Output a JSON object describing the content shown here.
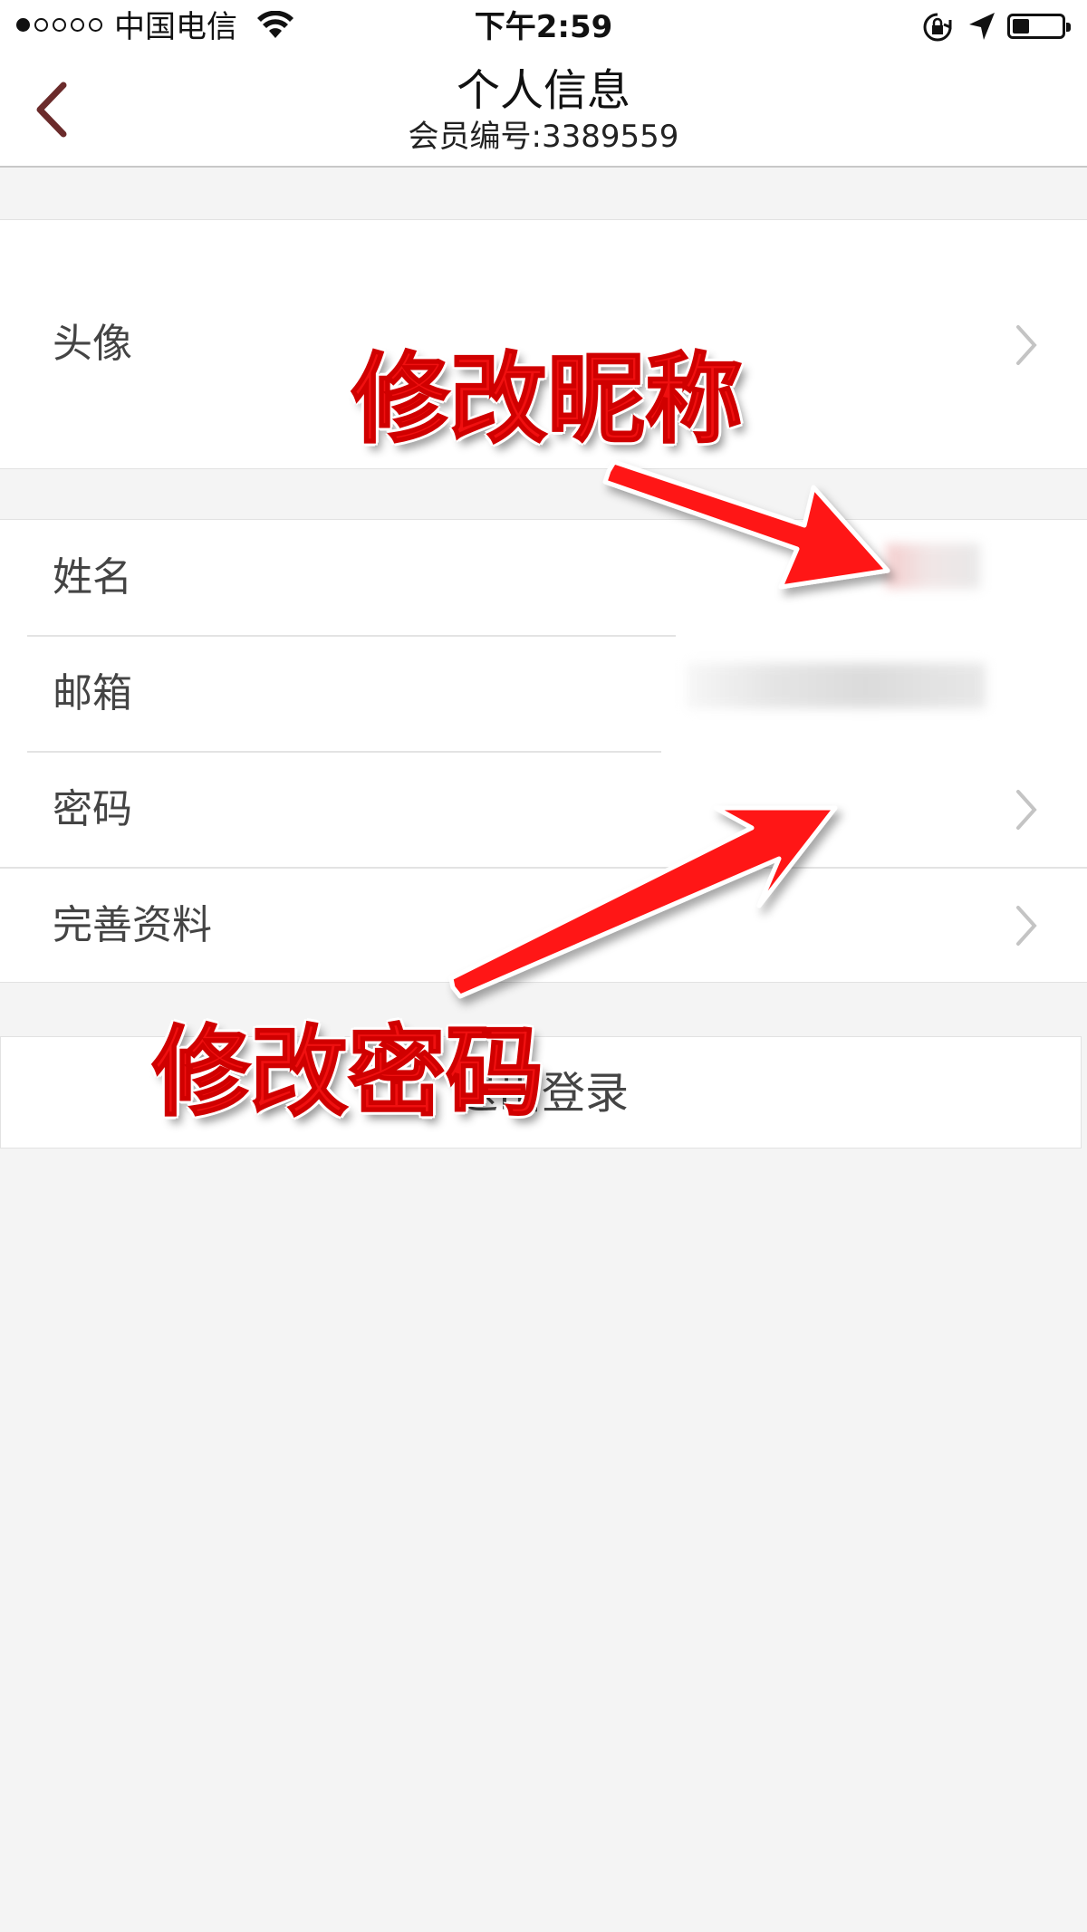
{
  "status_bar": {
    "carrier": "中国电信",
    "time": "下午2:59",
    "signal_filled": 1,
    "signal_total": 5,
    "battery_level": 0.35,
    "icons": [
      "wifi-icon",
      "orientation-lock-icon",
      "location-arrow-icon",
      "battery-icon"
    ]
  },
  "nav": {
    "back_icon": "chevron-left-icon",
    "title": "个人信息",
    "subtitle": "会员编号:3389559"
  },
  "rows": {
    "avatar": "头像",
    "name": "姓名",
    "email": "邮箱",
    "password": "密码",
    "complete_profile": "完善资料"
  },
  "logout": {
    "label": "退出登录"
  },
  "annotations": {
    "edit_nickname": "修改昵称",
    "edit_password": "修改密码"
  },
  "colors": {
    "accent_back": "#6b2b2b",
    "annotation": "#f01010",
    "background": "#f4f4f4",
    "row_bg": "#ffffff"
  }
}
